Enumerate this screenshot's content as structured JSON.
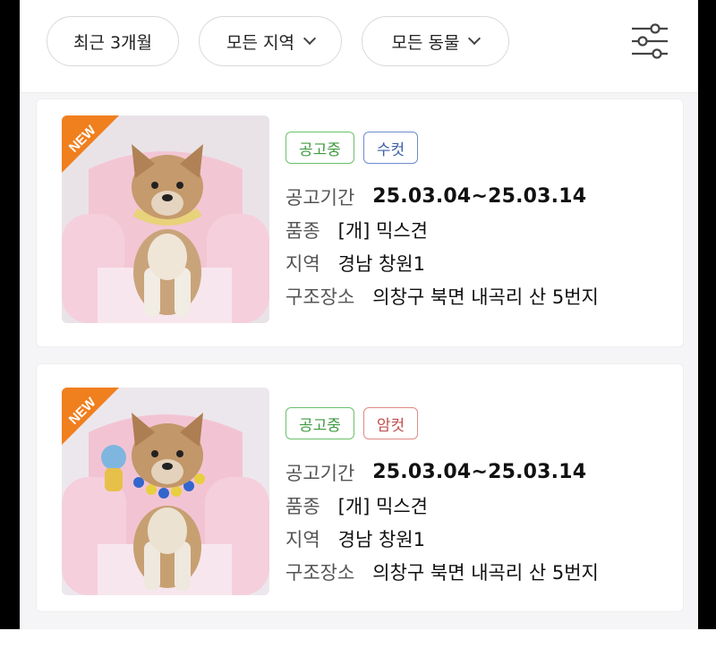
{
  "filters": {
    "period": "최근 3개월",
    "region": "모든 지역",
    "animal": "모든 동물"
  },
  "icons": {
    "settings": "sliders-icon",
    "chevron": "chevron-down-icon"
  },
  "colors": {
    "status_green": "#3f9a3f",
    "male_blue": "#3c5fa8",
    "female_red": "#c0504d",
    "new_orange": "#f07f1e"
  },
  "listings": [
    {
      "new_label": "NEW",
      "status": "공고중",
      "sex": "수컷",
      "period_label": "공고기간",
      "period": "25.03.04~25.03.14",
      "breed_label": "품종",
      "breed": "[개] 믹스견",
      "region_label": "지역",
      "region": "경남 창원1",
      "rescue_label": "구조장소",
      "rescue_place": "의창구 북면 내곡리 산 5번지"
    },
    {
      "new_label": "NEW",
      "status": "공고중",
      "sex": "암컷",
      "period_label": "공고기간",
      "period": "25.03.04~25.03.14",
      "breed_label": "품종",
      "breed": "[개] 믹스견",
      "region_label": "지역",
      "region": "경남 창원1",
      "rescue_label": "구조장소",
      "rescue_place": "의창구 북면 내곡리 산 5번지"
    }
  ]
}
